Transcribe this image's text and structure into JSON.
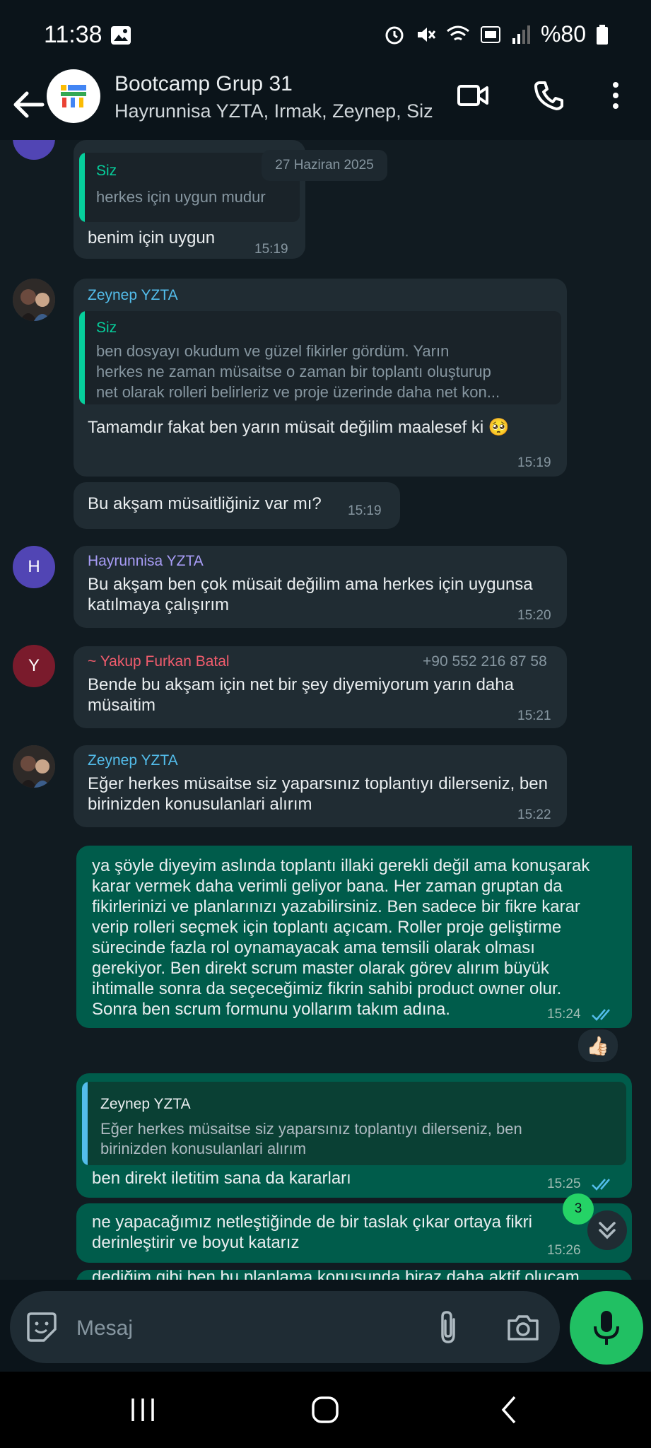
{
  "status_bar": {
    "time": "11:38",
    "battery": "%80"
  },
  "header": {
    "title": "Bootcamp Grup 31",
    "subtitle": "Hayrunnisa YZTA, Irmak, Zeynep, Siz"
  },
  "date_chip": "27 Haziran 2025",
  "messages": [
    {
      "quote_sender": "Siz",
      "quote_text": "herkes için uygun mudur",
      "text": "benim için uygun",
      "time": "15:19"
    },
    {
      "sender": "Zeynep YZTA",
      "quote_sender": "Siz",
      "quote_text_lines": [
        "ben dosyayı okudum ve güzel fikirler gördüm. Yarın",
        "herkes ne zaman müsaitse o zaman bir toplantı oluşturup",
        "net olarak rolleri belirleriz ve proje üzerinde daha net kon..."
      ],
      "text": "Tamamdır fakat ben yarın müsait değilim maalesef ki 🥺",
      "time": "15:19"
    },
    {
      "text": "Bu akşam müsaitliğiniz var mı?",
      "time": "15:19"
    },
    {
      "sender": "Hayrunnisa YZTA",
      "avatar_letter": "H",
      "text_lines": [
        "Bu akşam ben çok müsait değilim ama herkes için uygunsa",
        "katılmaya çalışırım"
      ],
      "time": "15:20"
    },
    {
      "sender": "~ Yakup Furkan Batal",
      "phone": "+90 552 216 87 58",
      "avatar_letter": "Y",
      "text_lines": [
        "Bende bu akşam için net bir şey diyemiyorum yarın daha",
        "müsaitim"
      ],
      "time": "15:21"
    },
    {
      "sender": "Zeynep YZTA",
      "text_lines": [
        "Eğer herkes müsaitse siz yaparsınız toplantıyı dilerseniz, ben",
        "birinizden konusulanlari alırım"
      ],
      "time": "15:22"
    },
    {
      "text_lines": [
        "ya şöyle diyeyim aslında toplantı illaki gerekli değil ama konuşarak",
        "karar vermek daha verimli geliyor bana. Her zaman gruptan da",
        "fikirlerinizi ve planlarınızı yazabilirsiniz. Ben sadece bir fikre karar",
        "verip rolleri seçmek için toplantı açıcam. Roller proje geliştirme",
        "sürecinde fazla rol oynamayacak ama temsili olarak olması",
        "gerekiyor. Ben direkt scrum master olarak görev alırım büyük",
        "ihtimalle sonra da seçeceğimiz fikrin sahibi product owner olur.",
        "Sonra ben scrum formunu yollarım takım adına."
      ],
      "time": "15:24",
      "reaction": "👍🏻"
    },
    {
      "quote_sender": "Zeynep YZTA",
      "quote_text_lines": [
        "Eğer herkes müsaitse siz yaparsınız toplantıyı dilerseniz, ben",
        "birinizden konusulanlari alırım"
      ],
      "text": "ben direkt iletitim sana da kararları",
      "time": "15:25"
    },
    {
      "text_lines": [
        "ne yapacağımız netleştiğinde de bir taslak çıkar ortaya fikri",
        "derinleştirir ve boyut katarız"
      ],
      "time": "15:26"
    },
    {
      "text": "dediğim gibi ben bu planlama konusunda biraz daha aktif olucam"
    }
  ],
  "unread_badge": "3",
  "input": {
    "placeholder": "Mesaj"
  },
  "colors": {
    "incoming": "#202c33",
    "outgoing": "#005c4b",
    "accent": "#25d366",
    "zeynep": "#53bdeb",
    "hayrunnisa": "#a79cf5",
    "yakup": "#f15c6d"
  }
}
